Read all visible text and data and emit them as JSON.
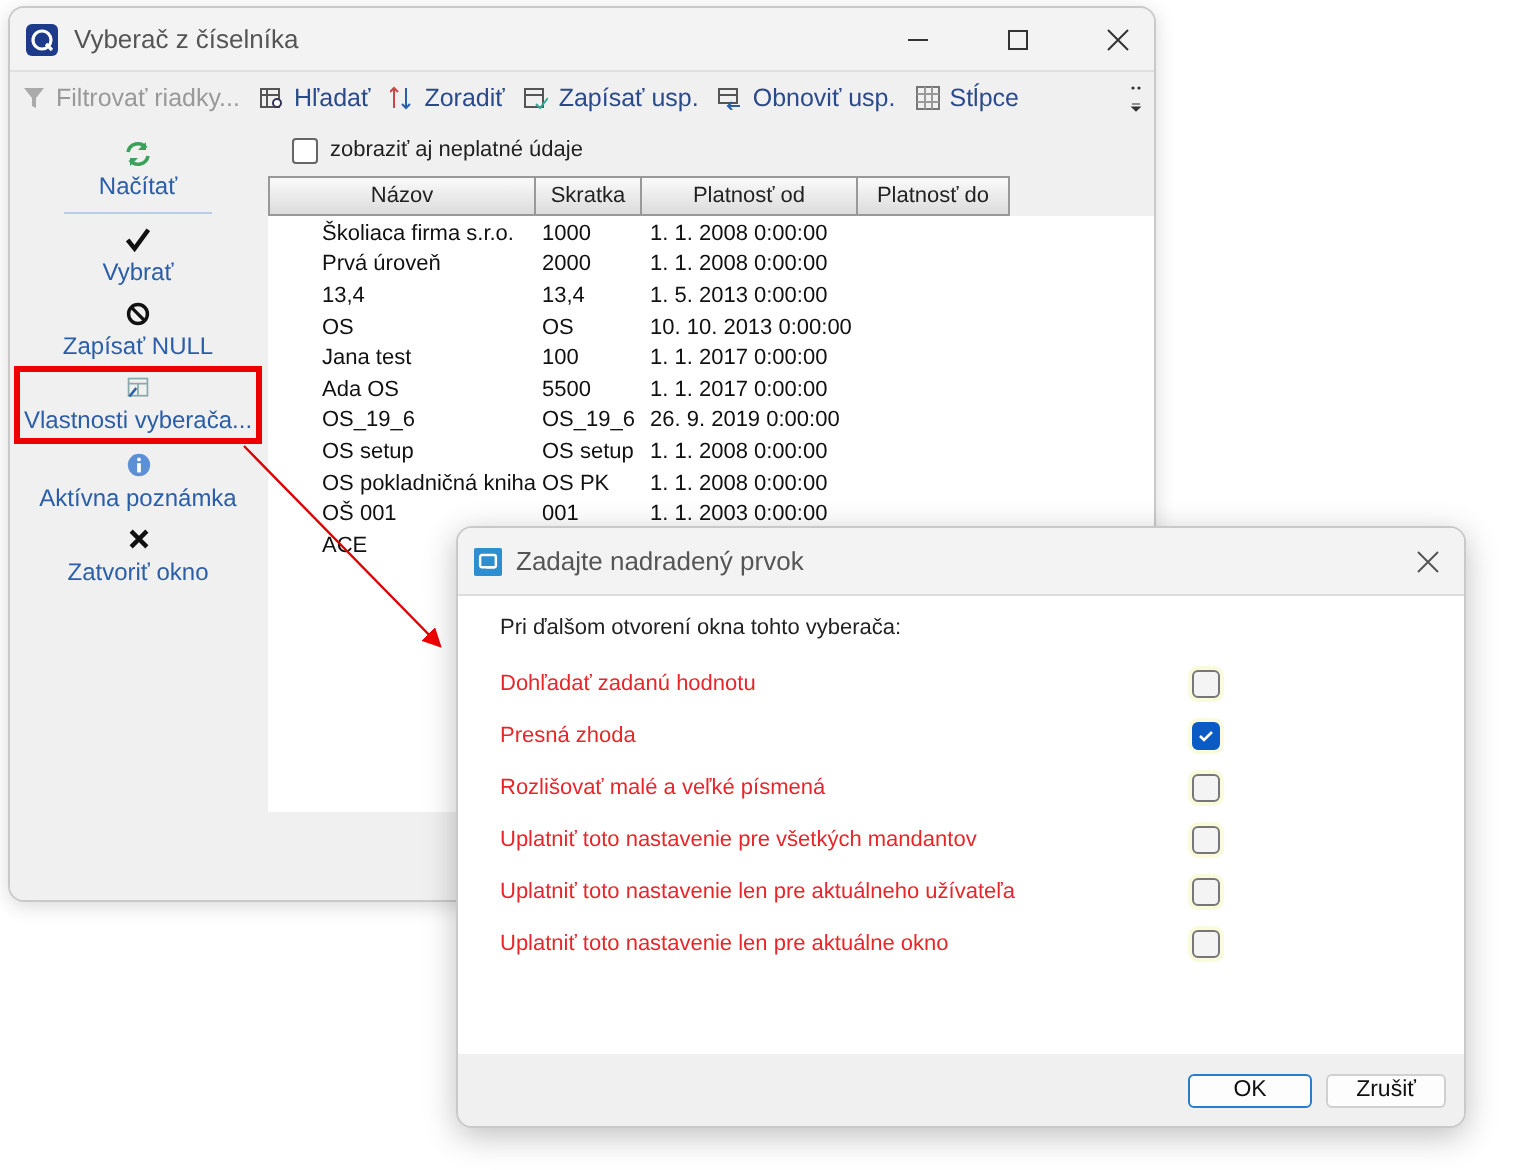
{
  "main_window": {
    "title": "Vyberač z číselníka",
    "toolbar": [
      {
        "label": "Filtrovať riadky...",
        "kind": "filter",
        "disabled": true
      },
      {
        "label": "Hľadať",
        "kind": "find",
        "disabled": false
      },
      {
        "label": "Zoradiť",
        "kind": "sort",
        "disabled": false
      },
      {
        "label": "Zapísať usp.",
        "kind": "save",
        "disabled": false
      },
      {
        "label": "Obnoviť usp.",
        "kind": "restore",
        "disabled": false
      },
      {
        "label": "Stĺpce",
        "kind": "columns",
        "disabled": false
      }
    ],
    "sidebar": [
      {
        "label": "Načítať",
        "kind": "refresh",
        "highlighted": false
      },
      {
        "label": "Vybrať",
        "kind": "check",
        "highlighted": false
      },
      {
        "label": "Zapísať NULL",
        "kind": "block",
        "highlighted": false
      },
      {
        "label": "Vlastnosti vyberača...",
        "kind": "properties",
        "highlighted": true
      },
      {
        "label": "Aktívna poznámka",
        "kind": "info",
        "highlighted": false
      },
      {
        "label": "Zatvoriť okno",
        "kind": "close",
        "highlighted": false
      }
    ],
    "show_invalid": {
      "label": "zobraziť aj neplatné údaje",
      "checked": false
    },
    "table": {
      "columns": [
        "Názov",
        "Skratka",
        "Platnosť od",
        "Platnosť do"
      ],
      "rows": [
        [
          "Školiaca firma  s.r.o.",
          "1000",
          "1. 1. 2008 0:00:00"
        ],
        [
          "Prvá úroveň",
          "2000",
          "1. 1. 2008 0:00:00"
        ],
        [
          "13,4",
          "13,4",
          "1. 5. 2013 0:00:00"
        ],
        [
          "OS",
          "OS",
          "10. 10. 2013 0:00:00"
        ],
        [
          "Jana test",
          "100",
          "1. 1. 2017 0:00:00"
        ],
        [
          "Ada OS",
          "5500",
          "1. 1. 2017 0:00:00"
        ],
        [
          "OS_19_6",
          "OS_19_6",
          "26. 9. 2019 0:00:00"
        ],
        [
          "OS setup",
          "OS setup",
          "1. 1. 2008 0:00:00"
        ],
        [
          "OS pokladničná kniha",
          "OS PK",
          "1. 1. 2008 0:00:00"
        ],
        [
          "OŠ 001",
          "001",
          "1. 1. 2003 0:00:00"
        ],
        [
          "ACE"
        ]
      ]
    }
  },
  "dialog": {
    "title": "Zadajte nadradený prvok",
    "intro": "Pri ďalšom otvorení okna tohto vyberača:",
    "options": [
      {
        "label": "Dohľadať zadanú hodnotu",
        "checked": false
      },
      {
        "label": "Presná zhoda",
        "checked": true
      },
      {
        "label": "Rozlišovať malé a veľké písmená",
        "checked": false
      },
      {
        "label": "Uplatniť toto nastavenie pre všetkých mandantov",
        "checked": false
      },
      {
        "label": "Uplatniť toto nastavenie len pre aktuálneho užívateľa",
        "checked": false
      },
      {
        "label": "Uplatniť toto nastavenie len pre aktuálne okno",
        "checked": false
      }
    ],
    "buttons": [
      "OK",
      "Zrušiť"
    ]
  }
}
